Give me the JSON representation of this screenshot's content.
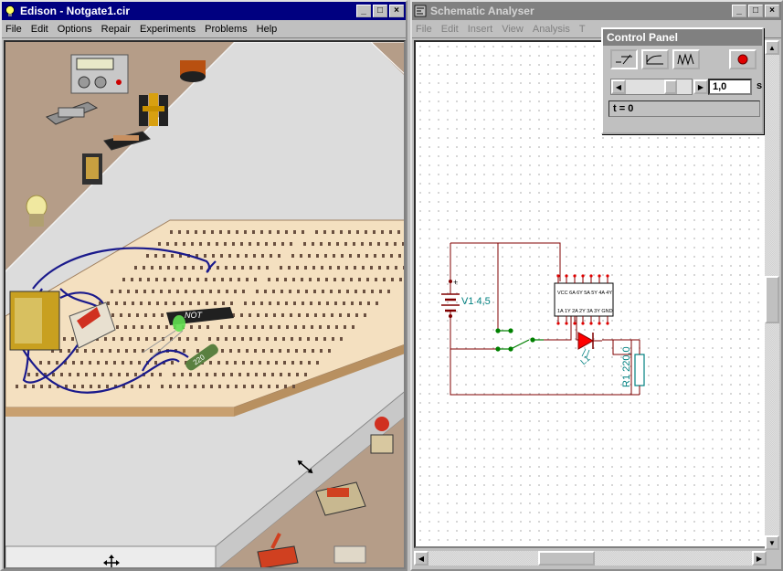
{
  "edison": {
    "title": "Edison - Notgate1.cir",
    "menu": [
      "File",
      "Edit",
      "Options",
      "Repair",
      "Experiments",
      "Problems",
      "Help"
    ],
    "chip_label": "NOT",
    "resistor_label": "220"
  },
  "schematic": {
    "title": "Schematic Analyser",
    "menu": [
      "File",
      "Edit",
      "Insert",
      "View",
      "Analysis",
      "T"
    ],
    "battery_label": "V1 4,5",
    "resistor_label": "R1 220,0",
    "led_label": "L1",
    "battery_plus": "+",
    "chip_pins_top": "VCC 6A 6Y 5A 5Y 4A 4Y",
    "chip_pins_bottom": "1A 1Y 2A 2Y 3A 3Y GND"
  },
  "control_panel": {
    "title": "Control Panel",
    "time_value": "1,0",
    "time_unit": "s",
    "status": "t =  0",
    "mode_buttons": [
      "dc-mode",
      "transient-mode",
      "ac-mode"
    ]
  },
  "colors": {
    "title_active": "#000080",
    "title_inactive": "#808080",
    "wire_blue": "#1a1a8c",
    "schematic_wire": "#800000",
    "schematic_switch": "#008000",
    "led_red": "#ff0000"
  }
}
